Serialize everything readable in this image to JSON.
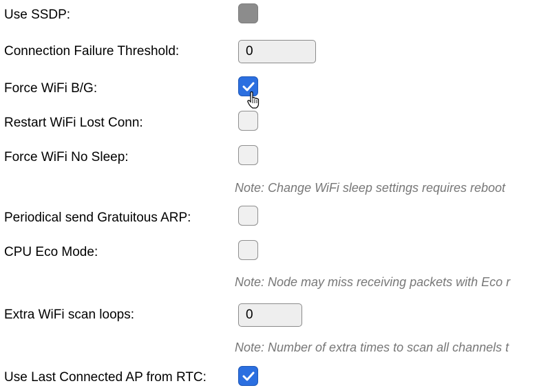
{
  "settings": [
    {
      "label": "Use SSDP:",
      "type": "checkbox",
      "state": "disabled"
    },
    {
      "label": "Connection Failure Threshold:",
      "type": "number",
      "value": "0"
    },
    {
      "label": "Force WiFi B/G:",
      "type": "checkbox",
      "state": "checked"
    },
    {
      "label": "Restart WiFi Lost Conn:",
      "type": "checkbox",
      "state": "unchecked"
    },
    {
      "label": "Force WiFi No Sleep:",
      "type": "checkbox",
      "state": "unchecked"
    },
    {
      "label": "Periodical send Gratuitous ARP:",
      "type": "checkbox",
      "state": "unchecked"
    },
    {
      "label": "CPU Eco Mode:",
      "type": "checkbox",
      "state": "unchecked"
    },
    {
      "label": "Extra WiFi scan loops:",
      "type": "number",
      "value": "0"
    },
    {
      "label": "Use Last Connected AP from RTC:",
      "type": "checkbox",
      "state": "checked"
    }
  ],
  "notes": {
    "wifi_sleep": "Note: Change WiFi sleep settings requires reboot",
    "eco_mode": "Note: Node may miss receiving packets with Eco r",
    "scan_loops": "Note: Number of extra times to scan all channels t"
  },
  "colors": {
    "checkbox_checked": "#2b6fe0",
    "checkbox_disabled": "#8c8c8c",
    "note_text": "#777777"
  },
  "icons": {
    "check": "check-icon",
    "cursor": "hand-pointer-icon"
  }
}
